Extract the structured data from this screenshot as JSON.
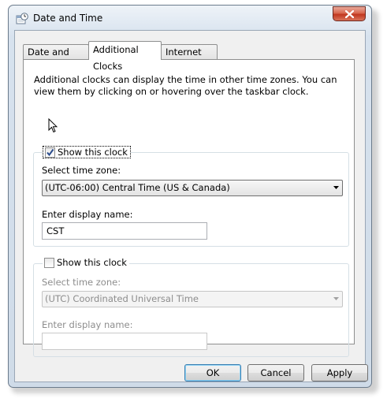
{
  "window": {
    "title": "Date and Time",
    "icon": "clock-calendar-icon"
  },
  "tabs": [
    {
      "label": "Date and Time",
      "active": false
    },
    {
      "label": "Additional Clocks",
      "active": true
    },
    {
      "label": "Internet Time",
      "active": false
    }
  ],
  "description": "Additional clocks can display the time in other time zones. You can view them by clicking on or hovering over the taskbar clock.",
  "clock1": {
    "show_label": "Show this clock",
    "checked": true,
    "timezone_label": "Select time zone:",
    "timezone_value": "(UTC-06:00) Central Time (US & Canada)",
    "display_name_label": "Enter display name:",
    "display_name_value": "CST"
  },
  "clock2": {
    "show_label": "Show this clock",
    "checked": false,
    "timezone_label": "Select time zone:",
    "timezone_value": "(UTC) Coordinated Universal Time",
    "display_name_label": "Enter display name:",
    "display_name_value": ""
  },
  "buttons": {
    "ok": "OK",
    "cancel": "Cancel",
    "apply": "Apply"
  }
}
